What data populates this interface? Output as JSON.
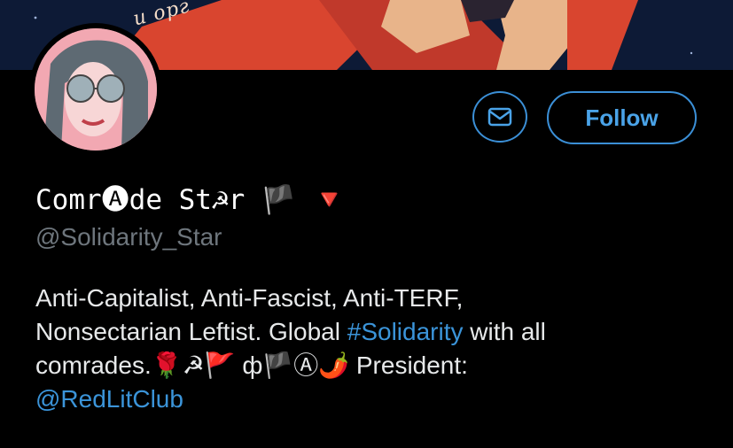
{
  "banner": {
    "text": "и орг"
  },
  "profile": {
    "display_name": "Comr🅐de St☭r 🏴 🔻",
    "handle": "@Solidarity_Star"
  },
  "actions": {
    "message_icon": "envelope-icon",
    "follow_label": "Follow"
  },
  "bio": {
    "line1": "Anti-Capitalist, Anti-Fascist, Anti-TERF,",
    "line2_pre": "Nonsectarian Leftist. Global ",
    "hashtag": "#Solidarity",
    "line2_post": " with all",
    "line3": "comrades.🌹☭🚩 ф🏴Ⓐ🌶️ President:",
    "mention": "@RedLitClub"
  },
  "colors": {
    "accent": "#3b8fd6",
    "background": "#000000",
    "secondary_text": "#6e767d"
  }
}
